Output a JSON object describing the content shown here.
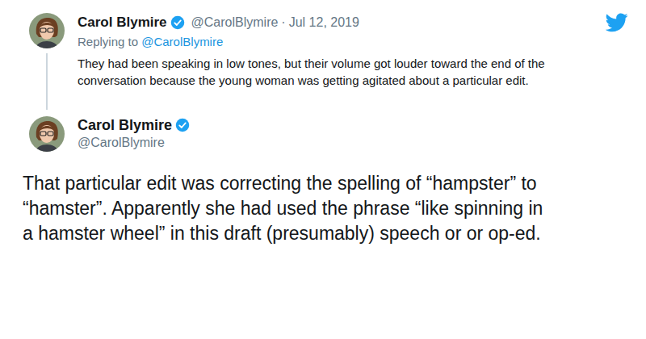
{
  "reply": {
    "author": {
      "name": "Carol Blymire",
      "verified": true,
      "handle": "@CarolBlymire"
    },
    "separator": "·",
    "date": "Jul 12, 2019",
    "replying_to": {
      "label": "Replying to",
      "handle": "@CarolBlymire"
    },
    "text": "They had been speaking in low tones, but their volume got louder toward the end of the conversation because the young woman was getting agitated about a particular edit."
  },
  "main": {
    "author": {
      "name": "Carol Blymire",
      "verified": true,
      "handle": "@CarolBlymire"
    },
    "text": "That particular edit was correcting the spelling of “hampster” to “hamster”. Apparently she had used the phrase “like spinning in a hamster wheel” in this draft (presumably) speech or or op-ed."
  }
}
